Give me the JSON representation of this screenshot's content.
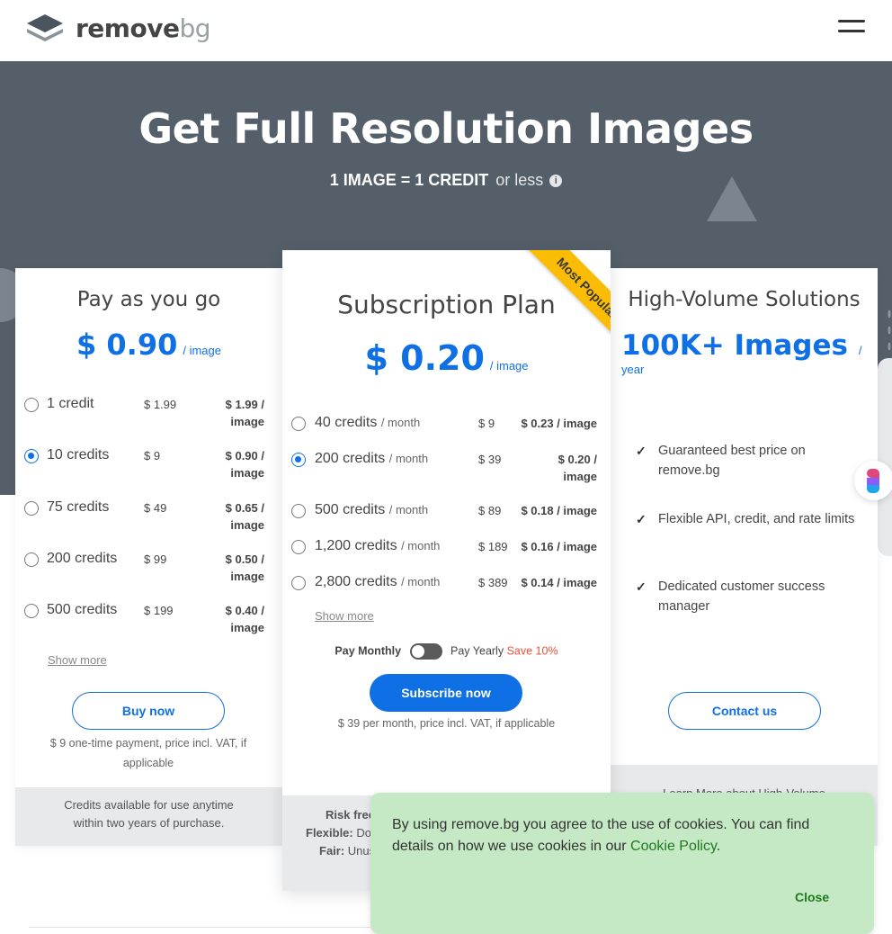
{
  "header": {
    "logo_main": "remove",
    "logo_suffix": "bg",
    "menu_icon": "hamburger-icon"
  },
  "hero": {
    "title": "Get Full Resolution Images",
    "subtitle_bold": "1 IMAGE = 1 CREDIT",
    "subtitle_light": "or less",
    "info_glyph": "i"
  },
  "pay_as_you_go": {
    "title": "Pay as you go",
    "price": "$ 0.90",
    "price_unit": "/ image",
    "options": [
      {
        "label": "1 credit",
        "price": "$ 1.99",
        "per_image": "$ 1.99 /",
        "per_image2": "image",
        "selected": false
      },
      {
        "label": "10 credits",
        "price": "$ 9",
        "per_image": "$ 0.90 /",
        "per_image2": "image",
        "selected": true
      },
      {
        "label": "75 credits",
        "price": "$ 49",
        "per_image": "$ 0.65 /",
        "per_image2": "image",
        "selected": false
      },
      {
        "label": "200 credits",
        "price": "$ 99",
        "per_image": "$ 0.50 /",
        "per_image2": "image",
        "selected": false
      },
      {
        "label": "500 credits",
        "price": "$ 199",
        "per_image": "$ 0.40 /",
        "per_image2": "image",
        "selected": false
      }
    ],
    "show_more": "Show more",
    "button": "Buy now",
    "note": "$ 9 one-time payment, price incl. VAT, if applicable",
    "footer": "Credits available for use anytime within two years of purchase."
  },
  "subscription": {
    "title": "Subscription Plan",
    "ribbon": "Most Popular",
    "price": "$ 0.20",
    "price_unit": "/ image",
    "options": [
      {
        "label": "40 credits",
        "period": "/ month",
        "price": "$ 9",
        "per_image": "$ 0.23 / image",
        "per_image2": "",
        "selected": false
      },
      {
        "label": "200 credits",
        "period": "/ month",
        "price": "$ 39",
        "per_image": "$ 0.20 /",
        "per_image2": "image",
        "selected": true
      },
      {
        "label": "500 credits",
        "period": "/ month",
        "price": "$ 89",
        "per_image": "$ 0.18 / image",
        "per_image2": "",
        "selected": false
      },
      {
        "label": "1,200 credits",
        "period": "/ month",
        "price": "$ 189",
        "per_image": "$ 0.16 / image",
        "per_image2": "",
        "selected": false
      },
      {
        "label": "2,800 credits",
        "period": "/ month",
        "price": "$ 389",
        "per_image": "$ 0.14 / image",
        "per_image2": "",
        "selected": false
      }
    ],
    "show_more": "Show more",
    "toggle_monthly": "Pay Monthly",
    "toggle_yearly": "Pay Yearly",
    "toggle_save": "Save 10%",
    "button": "Subscribe now",
    "note": "$ 39 per month, price incl. VAT, if applicable",
    "footer_line1_label": "Risk free",
    "footer_line2_label": "Flexible:",
    "footer_line2_text": "Do",
    "footer_line3_label": "Fair:",
    "footer_line3_text": "Unus"
  },
  "high_volume": {
    "title": "High-Volume Solutions",
    "price": "100K+ Images",
    "price_unit": "/ year",
    "features": [
      "Guaranteed best price on remove.bg",
      "Flexible API, credit, and rate limits",
      "Dedicated customer success manager"
    ],
    "button": "Contact us",
    "footer": "Learn More about High-Volume"
  },
  "cookie": {
    "text": "By using remove.bg you agree to the use of cookies. You can find details on how we use cookies in our",
    "link": "Cookie Policy",
    "link_suffix": ".",
    "close": "Close"
  },
  "colors": {
    "accent": "#0f70e6",
    "hero_bg": "#545f6a",
    "ribbon": "#fbbc05",
    "cookie_bg": "#c6e9c5",
    "save": "#e5533d"
  }
}
